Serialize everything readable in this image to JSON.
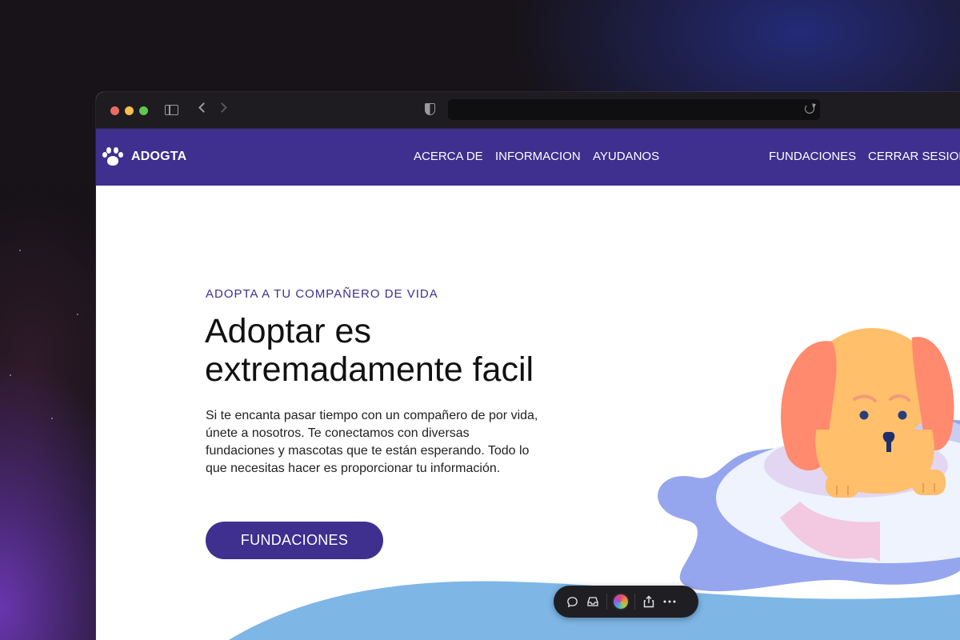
{
  "browser": {
    "url": ""
  },
  "nav": {
    "brand": "ADOGTA",
    "links": [
      "ACERCA DE",
      "INFORMACION",
      "AYUDANOS"
    ],
    "right_links": [
      "FUNDACIONES",
      "CERRAR SESION"
    ]
  },
  "hero": {
    "eyebrow": "ADOPTA A TU COMPAÑERO DE VIDA",
    "headline_line1": "Adoptar es",
    "headline_line2": "extremadamente facil",
    "description": "Si te encanta pasar tiempo con un compañero de por vida, únete a nosotros. Te conectamos con diversas fundaciones y mascotas que te están esperando. Todo lo que necesitas hacer es proporcionar tu información.",
    "cta": "FUNDACIONES"
  },
  "colors": {
    "brand_purple": "#3f2f8f",
    "wave_blue": "#7eb6e6",
    "dog_orange": "#ffbf6b",
    "ear_coral": "#ff8a6e",
    "puddle_blue": "#96a6ee"
  },
  "float_toolbar": {
    "icons": [
      "comment-icon",
      "inbox-icon",
      "avatar",
      "share-icon",
      "more-icon"
    ]
  }
}
